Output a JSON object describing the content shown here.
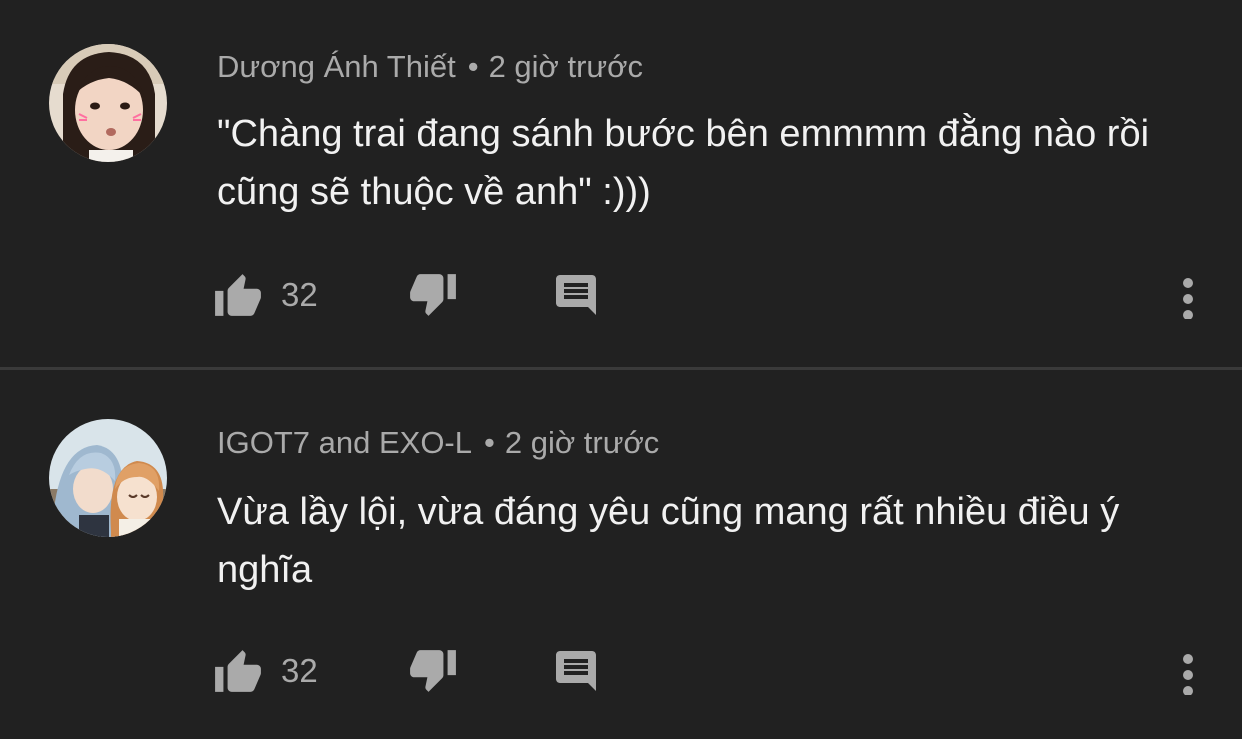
{
  "comments": [
    {
      "author": "Dương Ánh Thiết",
      "separator": "•",
      "time": "2 giờ trước",
      "text": "\"Chàng trai đang sánh bước bên emmmm đằng nào rồi cũng sẽ thuộc về anh\" :)))",
      "likes": "32",
      "avatar_icon": "girl-selfie-avatar"
    },
    {
      "author": "IGOT7 and EXO-L",
      "separator": "•",
      "time": "2 giờ trước",
      "text": "Vừa lầy lội, vừa đáng yêu cũng mang rất nhiều điều ý nghĩa",
      "likes": "32",
      "avatar_icon": "anime-couple-avatar"
    }
  ],
  "colors": {
    "background": "#212121",
    "text_primary": "#f1f1f1",
    "text_secondary": "#aaaaaa",
    "divider": "#3a3a3a"
  }
}
